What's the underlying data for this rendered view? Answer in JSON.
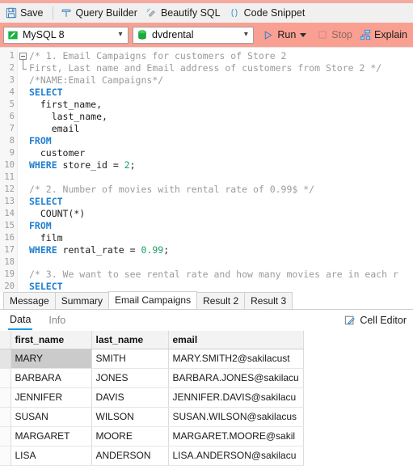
{
  "toolbar": {
    "buttons": [
      {
        "label": "Save",
        "icon": "save-icon"
      },
      {
        "label": "Query Builder",
        "icon": "query-builder-icon"
      },
      {
        "label": "Beautify SQL",
        "icon": "beautify-sql-icon"
      },
      {
        "label": "Code Snippet",
        "icon": "code-snippet-icon"
      }
    ]
  },
  "connection_bar": {
    "connection": {
      "value": "MySQL 8",
      "icon": "mysql-dolphin-icon"
    },
    "database": {
      "value": "dvdrental",
      "icon": "database-cylinder-icon"
    },
    "run_label": "Run",
    "stop_label": "Stop",
    "explain_label": "Explain"
  },
  "editor": {
    "lines": [
      {
        "n": "1",
        "tokens": [
          {
            "t": "comment",
            "s": "/* 1. Email Campaigns for customers of Store 2"
          }
        ]
      },
      {
        "n": "2",
        "tokens": [
          {
            "t": "comment",
            "s": "First, Last name and Email address of customers from Store 2 */"
          }
        ]
      },
      {
        "n": "3",
        "tokens": [
          {
            "t": "comment",
            "s": "/*NAME:Email Campaigns*/"
          }
        ]
      },
      {
        "n": "4",
        "tokens": [
          {
            "t": "kw",
            "s": "SELECT"
          }
        ]
      },
      {
        "n": "5",
        "tokens": [
          {
            "t": "plain",
            "s": "  first_name,"
          }
        ]
      },
      {
        "n": "6",
        "tokens": [
          {
            "t": "plain",
            "s": "    last_name,"
          }
        ]
      },
      {
        "n": "7",
        "tokens": [
          {
            "t": "plain",
            "s": "    email"
          }
        ]
      },
      {
        "n": "8",
        "tokens": [
          {
            "t": "kw",
            "s": "FROM"
          }
        ]
      },
      {
        "n": "9",
        "tokens": [
          {
            "t": "plain",
            "s": "  customer"
          }
        ]
      },
      {
        "n": "10",
        "tokens": [
          {
            "t": "kw",
            "s": "WHERE"
          },
          {
            "t": "plain",
            "s": " store_id = "
          },
          {
            "t": "num",
            "s": "2"
          },
          {
            "t": "plain",
            "s": ";"
          }
        ]
      },
      {
        "n": "11",
        "tokens": []
      },
      {
        "n": "12",
        "tokens": [
          {
            "t": "comment",
            "s": "/* 2. Number of movies with rental rate of 0.99$ */"
          }
        ]
      },
      {
        "n": "13",
        "tokens": [
          {
            "t": "kw",
            "s": "SELECT"
          }
        ]
      },
      {
        "n": "14",
        "tokens": [
          {
            "t": "plain",
            "s": "  COUNT(*)"
          }
        ]
      },
      {
        "n": "15",
        "tokens": [
          {
            "t": "kw",
            "s": "FROM"
          }
        ]
      },
      {
        "n": "16",
        "tokens": [
          {
            "t": "plain",
            "s": "  film"
          }
        ]
      },
      {
        "n": "17",
        "tokens": [
          {
            "t": "kw",
            "s": "WHERE"
          },
          {
            "t": "plain",
            "s": " rental_rate = "
          },
          {
            "t": "num",
            "s": "0.99"
          },
          {
            "t": "plain",
            "s": ";"
          }
        ]
      },
      {
        "n": "18",
        "tokens": []
      },
      {
        "n": "19",
        "tokens": [
          {
            "t": "comment",
            "s": "/* 3. We want to see rental rate and how many movies are in each r"
          }
        ]
      },
      {
        "n": "20",
        "tokens": [
          {
            "t": "kw",
            "s": "SELECT"
          }
        ]
      }
    ]
  },
  "result_tabs": [
    {
      "label": "Message",
      "active": false
    },
    {
      "label": "Summary",
      "active": false
    },
    {
      "label": "Email Campaigns",
      "active": true
    },
    {
      "label": "Result 2",
      "active": false
    },
    {
      "label": "Result 3",
      "active": false
    }
  ],
  "data_bar": {
    "subtabs": [
      {
        "label": "Data",
        "active": true
      },
      {
        "label": "Info",
        "active": false
      }
    ],
    "cell_editor_label": "Cell Editor"
  },
  "grid": {
    "columns": [
      "first_name",
      "last_name",
      "email"
    ],
    "rows": [
      {
        "cells": [
          "MARY",
          "SMITH",
          "MARY.SMITH2@sakilacust"
        ],
        "selected_index": 0
      },
      {
        "cells": [
          "BARBARA",
          "JONES",
          "BARBARA.JONES@sakilacu"
        ],
        "selected_index": -1
      },
      {
        "cells": [
          "JENNIFER",
          "DAVIS",
          "JENNIFER.DAVIS@sakilacu"
        ],
        "selected_index": -1
      },
      {
        "cells": [
          "SUSAN",
          "WILSON",
          "SUSAN.WILSON@sakilacus"
        ],
        "selected_index": -1
      },
      {
        "cells": [
          "MARGARET",
          "MOORE",
          "MARGARET.MOORE@sakil"
        ],
        "selected_index": -1
      },
      {
        "cells": [
          "LISA",
          "ANDERSON",
          "LISA.ANDERSON@sakilacu"
        ],
        "selected_index": -1
      }
    ]
  },
  "colors": {
    "accent_pink": "#f9a092",
    "accent_blue": "#1e9bdc",
    "keyword_blue": "#1f7fd0",
    "number_green": "#1a9e5f",
    "comment_gray": "#9b9b9b"
  }
}
